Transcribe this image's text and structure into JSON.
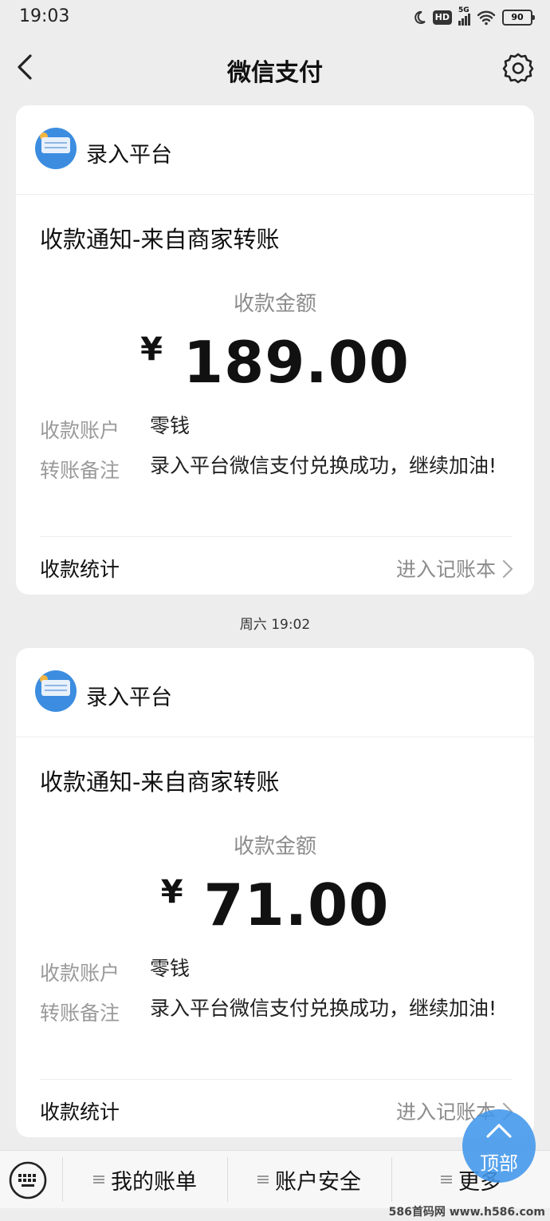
{
  "status_bar": {
    "time": "19:03",
    "signal": "5G",
    "hd": "HD",
    "battery": "90"
  },
  "nav": {
    "title": "微信支付"
  },
  "cards": [
    {
      "merchant": "录入平台",
      "notice_title": "收款通知-来自商家转账",
      "amount_label": "收款金额",
      "currency": "¥",
      "amount": "189.00",
      "account_label": "收款账户",
      "account_value": "零钱",
      "remark_label": "转账备注",
      "remark_value": "录入平台微信支付兑换成功，继续加油!",
      "stats_label": "收款统计",
      "ledger_link": "进入记账本"
    },
    {
      "merchant": "录入平台",
      "notice_title": "收款通知-来自商家转账",
      "amount_label": "收款金额",
      "currency": "¥",
      "amount": "71.00",
      "account_label": "收款账户",
      "account_value": "零钱",
      "remark_label": "转账备注",
      "remark_value": "录入平台微信支付兑换成功，继续加油!",
      "stats_label": "收款统计",
      "ledger_link": "进入记账本"
    }
  ],
  "timestamp": "周六  19:02",
  "bottom_menu": {
    "item1": "我的账单",
    "item2": "账户安全",
    "item3": "更多"
  },
  "top_button": {
    "label": "顶部"
  },
  "watermark": "586首码网 www.h586.com",
  "colors": {
    "accent": "#3c8de0",
    "background": "#ededed",
    "card": "#ffffff",
    "muted": "#8c8c8c"
  }
}
